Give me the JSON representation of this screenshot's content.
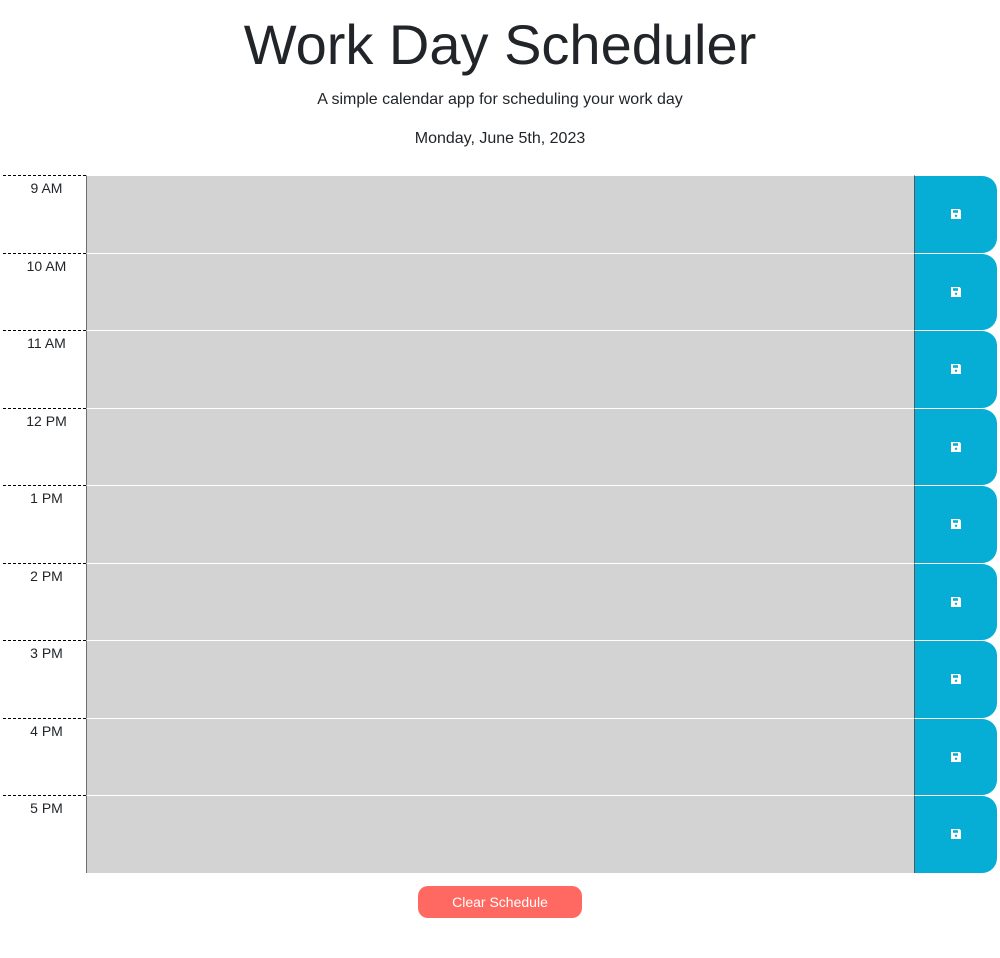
{
  "header": {
    "title": "Work Day Scheduler",
    "subtitle": "A simple calendar app for scheduling your work day",
    "current_day": "Monday, June 5th, 2023"
  },
  "time_blocks": [
    {
      "hour": "9 AM",
      "text": "",
      "status": "past"
    },
    {
      "hour": "10 AM",
      "text": "",
      "status": "past"
    },
    {
      "hour": "11 AM",
      "text": "",
      "status": "past"
    },
    {
      "hour": "12 PM",
      "text": "",
      "status": "past"
    },
    {
      "hour": "1 PM",
      "text": "",
      "status": "past"
    },
    {
      "hour": "2 PM",
      "text": "",
      "status": "past"
    },
    {
      "hour": "3 PM",
      "text": "",
      "status": "past"
    },
    {
      "hour": "4 PM",
      "text": "",
      "status": "past"
    },
    {
      "hour": "5 PM",
      "text": "",
      "status": "past"
    }
  ],
  "save_icon": "floppy-disk-icon",
  "clear_button": {
    "label": "Clear Schedule"
  },
  "colors": {
    "past": "#d3d3d3",
    "save_button": "#06aed5",
    "clear_button": "#ff6961"
  }
}
